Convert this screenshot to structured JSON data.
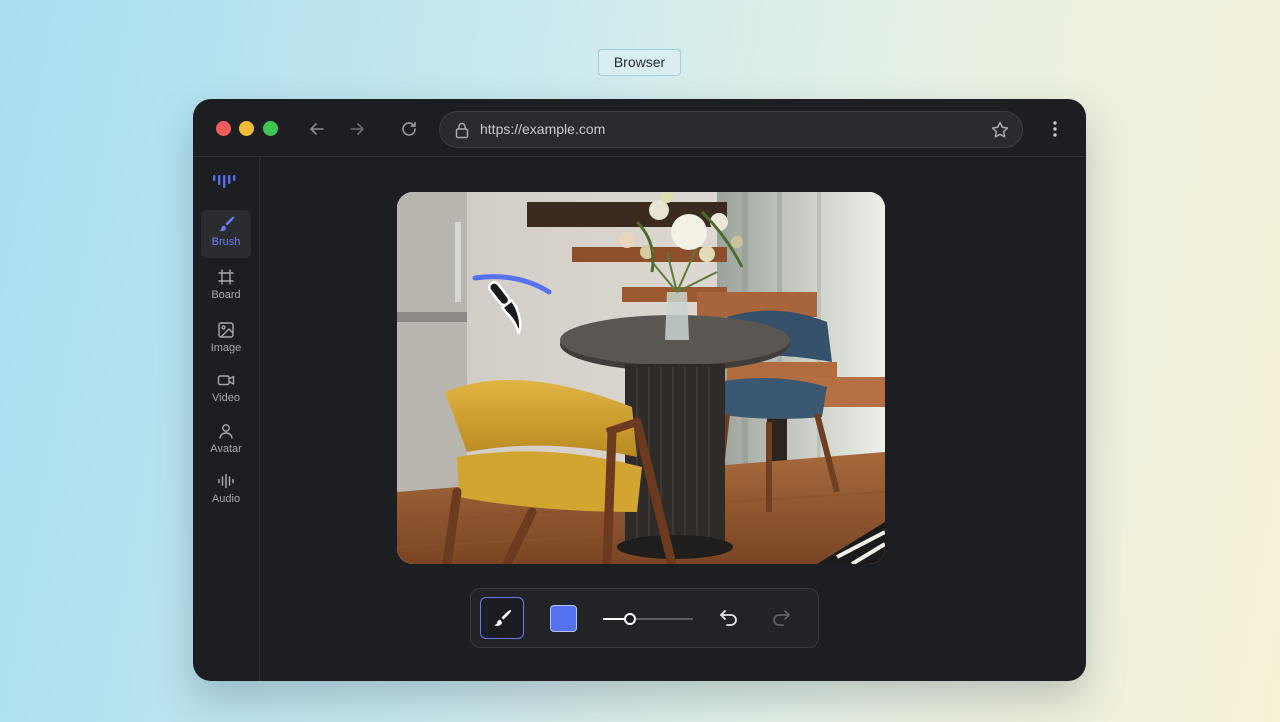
{
  "page_label": "Browser",
  "browser": {
    "url": "https://example.com",
    "traffic_lights": {
      "close": "#f15b5b",
      "minimize": "#f2bb3a",
      "maximize": "#3ec553"
    },
    "icons": [
      "back-arrow-icon",
      "forward-arrow-icon",
      "reload-icon",
      "lock-icon",
      "star-icon",
      "more-vertical-icon"
    ]
  },
  "sidebar": {
    "accent": "#6d7df5",
    "items": [
      {
        "label": "Brush",
        "icon": "brush-icon",
        "active": true
      },
      {
        "label": "Board",
        "icon": "board-frame-icon",
        "active": false
      },
      {
        "label": "Image",
        "icon": "image-icon",
        "active": false
      },
      {
        "label": "Video",
        "icon": "video-icon",
        "active": false
      },
      {
        "label": "Avatar",
        "icon": "avatar-icon",
        "active": false
      },
      {
        "label": "Audio",
        "icon": "audio-waveform-icon",
        "active": false
      }
    ]
  },
  "canvas": {
    "image_subject": "dining-room-photo",
    "stroke_color": "#5572f0"
  },
  "toolbar": {
    "tool": "brush",
    "color": "#5572f0",
    "brush_size_fraction": 0.3,
    "undo_enabled": true,
    "redo_enabled": false
  }
}
